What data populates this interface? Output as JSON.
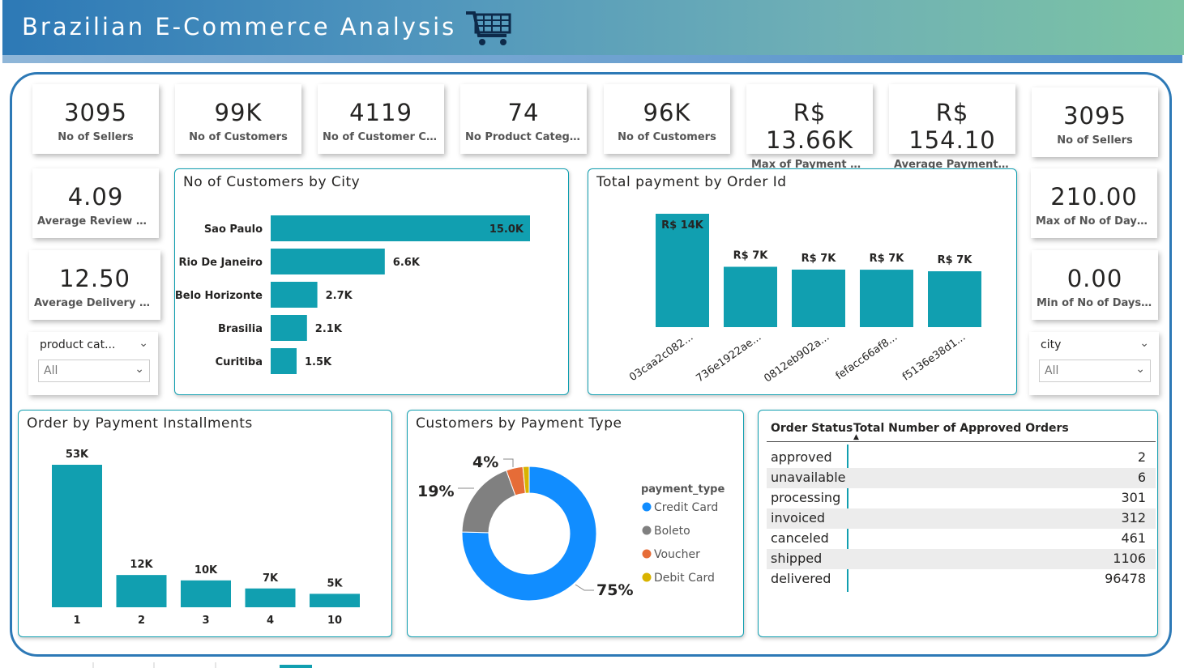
{
  "header": {
    "title": "Brazilian E-Commerce Analysis"
  },
  "kpis": [
    {
      "value": "3095",
      "label": "No of Sellers"
    },
    {
      "value": "99K",
      "label": "No of Customers"
    },
    {
      "value": "4119",
      "label": "No of Customer City"
    },
    {
      "value": "74",
      "label": "No Product Category"
    },
    {
      "value": "96K",
      "label": "No of  Customers"
    },
    {
      "value": "R$ 13.66K",
      "label": "Max of Payment Value"
    },
    {
      "value": "R$ 154.10",
      "label": "Average Payment Va..."
    },
    {
      "value": "3095",
      "label": "No of Sellers"
    },
    {
      "value": "4.09",
      "label": "Average Review Score"
    },
    {
      "value": "12.50",
      "label": "Average Delivery Days"
    },
    {
      "value": "210.00",
      "label": "Max of No of Days t..."
    },
    {
      "value": "0.00",
      "label": "Min of No of Days t..."
    }
  ],
  "slicers": {
    "product": {
      "title": "product cat...",
      "value": "All"
    },
    "city": {
      "title": "city",
      "value": "All"
    }
  },
  "charts": {
    "city": {
      "title": "No of Customers by City"
    },
    "payment_order": {
      "title": "Total payment by Order Id"
    },
    "installments": {
      "title": "Order by Payment Installments"
    },
    "payment_type": {
      "title": "Customers by Payment Type",
      "legend_title": "payment_type"
    }
  },
  "table": {
    "headers": [
      "Order Status",
      "Total Number of Approved Orders"
    ],
    "rows": [
      {
        "status": "approved",
        "count": "2"
      },
      {
        "status": "unavailable",
        "count": "6"
      },
      {
        "status": "processing",
        "count": "301"
      },
      {
        "status": "invoiced",
        "count": "312"
      },
      {
        "status": "canceled",
        "count": "461"
      },
      {
        "status": "shipped",
        "count": "1106"
      },
      {
        "status": "delivered",
        "count": "96478"
      }
    ]
  },
  "colors": {
    "accent": "#119fb0",
    "frame": "#2d79b6",
    "credit": "#118dff",
    "boleto": "#808080",
    "voucher": "#e66c37",
    "debit": "#d9b300"
  },
  "chart_data": [
    {
      "type": "bar",
      "orientation": "horizontal",
      "title": "No of Customers by City",
      "categories": [
        "Sao Paulo",
        "Rio De Janeiro",
        "Belo Horizonte",
        "Brasilia",
        "Curitiba"
      ],
      "values": [
        15000,
        6600,
        2700,
        2100,
        1500
      ],
      "labels": [
        "15.0K",
        "6.6K",
        "2.7K",
        "2.1K",
        "1.5K"
      ]
    },
    {
      "type": "bar",
      "title": "Total payment by Order Id",
      "categories": [
        "03caa2c082...",
        "736e1922ae...",
        "0812eb902a...",
        "fefacc66af8...",
        "f5136e38d1..."
      ],
      "values": [
        13660,
        7270,
        6930,
        6920,
        6730
      ],
      "labels": [
        "R$ 14K",
        "R$ 7K",
        "R$ 7K",
        "R$ 7K",
        "R$ 7K"
      ]
    },
    {
      "type": "bar",
      "title": "Order by Payment Installments",
      "categories": [
        "1",
        "2",
        "3",
        "4",
        "10"
      ],
      "values": [
        53000,
        12000,
        10000,
        7000,
        5000
      ],
      "labels": [
        "53K",
        "12K",
        "10K",
        "7K",
        "5K"
      ]
    },
    {
      "type": "pie",
      "title": "Customers by Payment Type",
      "legend_title": "payment_type",
      "categories": [
        "Credit Card",
        "Boleto",
        "Voucher",
        "Debit Card"
      ],
      "values": [
        75,
        19,
        4,
        1.5
      ],
      "labels": [
        "75%",
        "19%",
        "4%",
        ""
      ]
    }
  ]
}
